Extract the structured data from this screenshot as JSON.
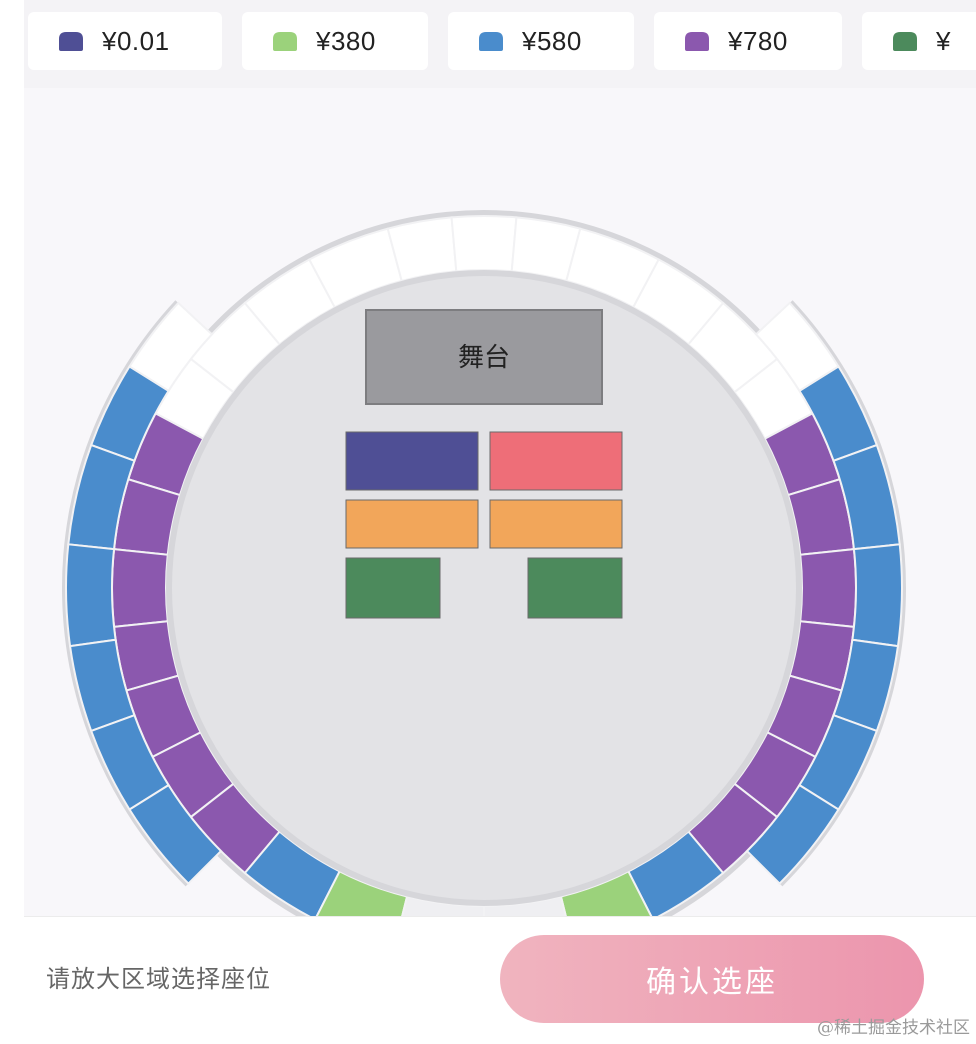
{
  "prices": [
    {
      "label": "¥0.01",
      "color": "#4f4f95"
    },
    {
      "label": "¥380",
      "color": "#9bd27b"
    },
    {
      "label": "¥580",
      "color": "#4a8ccc"
    },
    {
      "label": "¥780",
      "color": "#8b58ae"
    },
    {
      "label": "¥",
      "color": "#4c8a5c"
    }
  ],
  "stage": {
    "label": "舞台",
    "color": "#9a9a9e"
  },
  "floor_zone_colors": [
    "#4f4f95",
    "#ee6e78",
    "#f2a65a",
    "#f2a65a",
    "#4c8a5c",
    "#4c8a5c"
  ],
  "colors": {
    "white": "#ffffff",
    "blue": "#4a8ccc",
    "purple": "#8b58ae",
    "green": "#9bd27b",
    "light": "#efeff2",
    "arena": "#e3e3e6",
    "ring": "#d6d6da"
  },
  "bottom": {
    "hint": "请放大区域选择座位",
    "confirm_label": "确认选座"
  },
  "watermark": "@稀土掘金技术社区"
}
